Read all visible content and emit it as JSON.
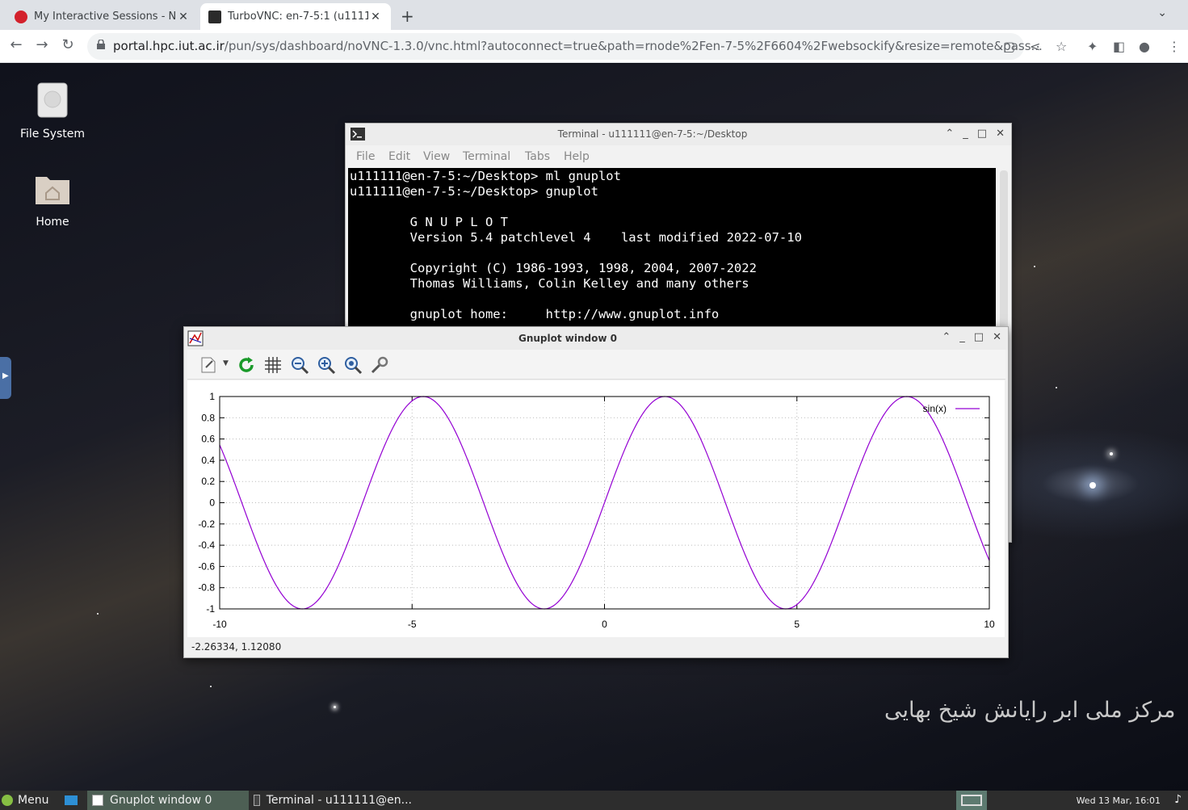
{
  "browser": {
    "tabs": [
      {
        "title": "My Interactive Sessions - NH",
        "active": false,
        "favicon_color": "#d3212c"
      },
      {
        "title": "TurboVNC: en-7-5:1 (u1111",
        "active": true,
        "favicon_color": "#2b2b2b"
      }
    ],
    "new_tab_label": "+",
    "url_host": "portal.hpc.iut.ac.ir",
    "url_path": "/pun/sys/dashboard/noVNC-1.3.0/vnc.html?autoconnect=true&path=rnode%2Fen-7-5%2F6604%2Fwebsockify&resize=remote&pass..."
  },
  "desktop": {
    "icons": [
      {
        "label": "File System"
      },
      {
        "label": "Home"
      }
    ],
    "watermark": "مرکز ملی ابر رایانش شیخ بهایی"
  },
  "terminal": {
    "title": "Terminal - u111111@en-7-5:~/Desktop",
    "menu": [
      "File",
      "Edit",
      "View",
      "Terminal",
      "Tabs",
      "Help"
    ],
    "lines": [
      "u111111@en-7-5:~/Desktop> ml gnuplot",
      "u111111@en-7-5:~/Desktop> gnuplot",
      "",
      "        G N U P L O T",
      "        Version 5.4 patchlevel 4    last modified 2022-07-10",
      "",
      "        Copyright (C) 1986-1993, 1998, 2004, 2007-2022",
      "        Thomas Williams, Colin Kelley and many others",
      "",
      "        gnuplot home:     http://www.gnuplot.info"
    ]
  },
  "gnuplot": {
    "title": "Gnuplot window 0",
    "status": "-2.26334,  1.12080"
  },
  "chart_data": {
    "type": "line",
    "function": "sin(x)",
    "xlim": [
      -10,
      10
    ],
    "ylim": [
      -1,
      1
    ],
    "xticks": [
      -10,
      -5,
      0,
      5,
      10
    ],
    "yticks": [
      1,
      0.8,
      0.6,
      0.4,
      0.2,
      0,
      -0.2,
      -0.4,
      -0.6,
      -0.8,
      -1
    ],
    "series": [
      {
        "name": "sin(x)",
        "color": "#9400d3"
      }
    ],
    "grid": true,
    "legend": "top-right"
  },
  "taskbar": {
    "menu_label": "Menu",
    "items": [
      "Gnuplot window 0",
      "Terminal - u111111@en..."
    ],
    "clock": "Wed 13 Mar, 16:01"
  }
}
